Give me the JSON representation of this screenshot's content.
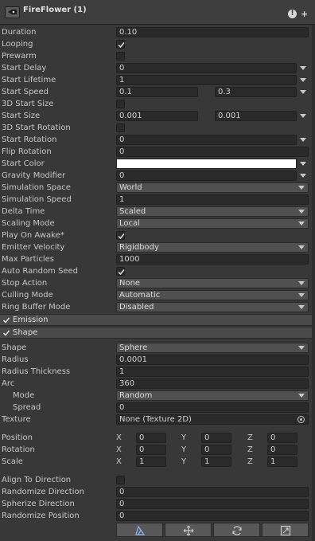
{
  "header": {
    "title": "FireFlower (1)"
  },
  "main": {
    "duration": {
      "label": "Duration",
      "value": "0.10"
    },
    "looping": {
      "label": "Looping",
      "checked": true
    },
    "prewarm": {
      "label": "Prewarm",
      "checked": false
    },
    "start_delay": {
      "label": "Start Delay",
      "value": "0"
    },
    "start_lifetime": {
      "label": "Start Lifetime",
      "value": "1"
    },
    "start_speed": {
      "label": "Start Speed",
      "min": "0.1",
      "max": "0.3"
    },
    "three_d_start_size": {
      "label": "3D Start Size",
      "checked": false
    },
    "start_size": {
      "label": "Start Size",
      "min": "0.001",
      "max": "0.001"
    },
    "three_d_start_rotation": {
      "label": "3D Start Rotation",
      "checked": false
    },
    "start_rotation": {
      "label": "Start Rotation",
      "value": "0"
    },
    "flip_rotation": {
      "label": "Flip Rotation",
      "value": "0"
    },
    "start_color": {
      "label": "Start Color",
      "color": "#ffffff"
    },
    "gravity_modifier": {
      "label": "Gravity Modifier",
      "value": "0"
    },
    "simulation_space": {
      "label": "Simulation Space",
      "value": "World"
    },
    "simulation_speed": {
      "label": "Simulation Speed",
      "value": "1"
    },
    "delta_time": {
      "label": "Delta Time",
      "value": "Scaled"
    },
    "scaling_mode": {
      "label": "Scaling Mode",
      "value": "Local"
    },
    "play_on_awake": {
      "label": "Play On Awake*",
      "checked": true
    },
    "emitter_velocity": {
      "label": "Emitter Velocity",
      "value": "Rigidbody"
    },
    "max_particles": {
      "label": "Max Particles",
      "value": "1000"
    },
    "auto_random_seed": {
      "label": "Auto Random Seed",
      "checked": true
    },
    "stop_action": {
      "label": "Stop Action",
      "value": "None"
    },
    "culling_mode": {
      "label": "Culling Mode",
      "value": "Automatic"
    },
    "ring_buffer_mode": {
      "label": "Ring Buffer Mode",
      "value": "Disabled"
    }
  },
  "modules": {
    "emission": {
      "label": "Emission",
      "enabled": true
    },
    "shape": {
      "label": "Shape",
      "enabled": true
    }
  },
  "shape": {
    "shape": {
      "label": "Shape",
      "value": "Sphere"
    },
    "radius": {
      "label": "Radius",
      "value": "0.0001"
    },
    "radius_thickness": {
      "label": "Radius Thickness",
      "value": "1"
    },
    "arc": {
      "label": "Arc",
      "value": "360"
    },
    "mode": {
      "label": "Mode",
      "value": "Random"
    },
    "spread": {
      "label": "Spread",
      "value": "0"
    },
    "texture": {
      "label": "Texture",
      "value": "None (Texture 2D)"
    },
    "axis": {
      "x": "X",
      "y": "Y",
      "z": "Z"
    },
    "position": {
      "label": "Position",
      "x": "0",
      "y": "0",
      "z": "0"
    },
    "rotation": {
      "label": "Rotation",
      "x": "0",
      "y": "0",
      "z": "0"
    },
    "scale": {
      "label": "Scale",
      "x": "1",
      "y": "1",
      "z": "1"
    },
    "align_to_direction": {
      "label": "Align To Direction",
      "checked": false
    },
    "randomize_direction": {
      "label": "Randomize Direction",
      "value": "0"
    },
    "spherize_direction": {
      "label": "Spherize Direction",
      "value": "0"
    },
    "randomize_position": {
      "label": "Randomize Position",
      "value": "0"
    }
  },
  "toolbar": {
    "icons": [
      "edit-shape-icon",
      "move-icon",
      "rotate-icon",
      "scale-icon"
    ]
  }
}
